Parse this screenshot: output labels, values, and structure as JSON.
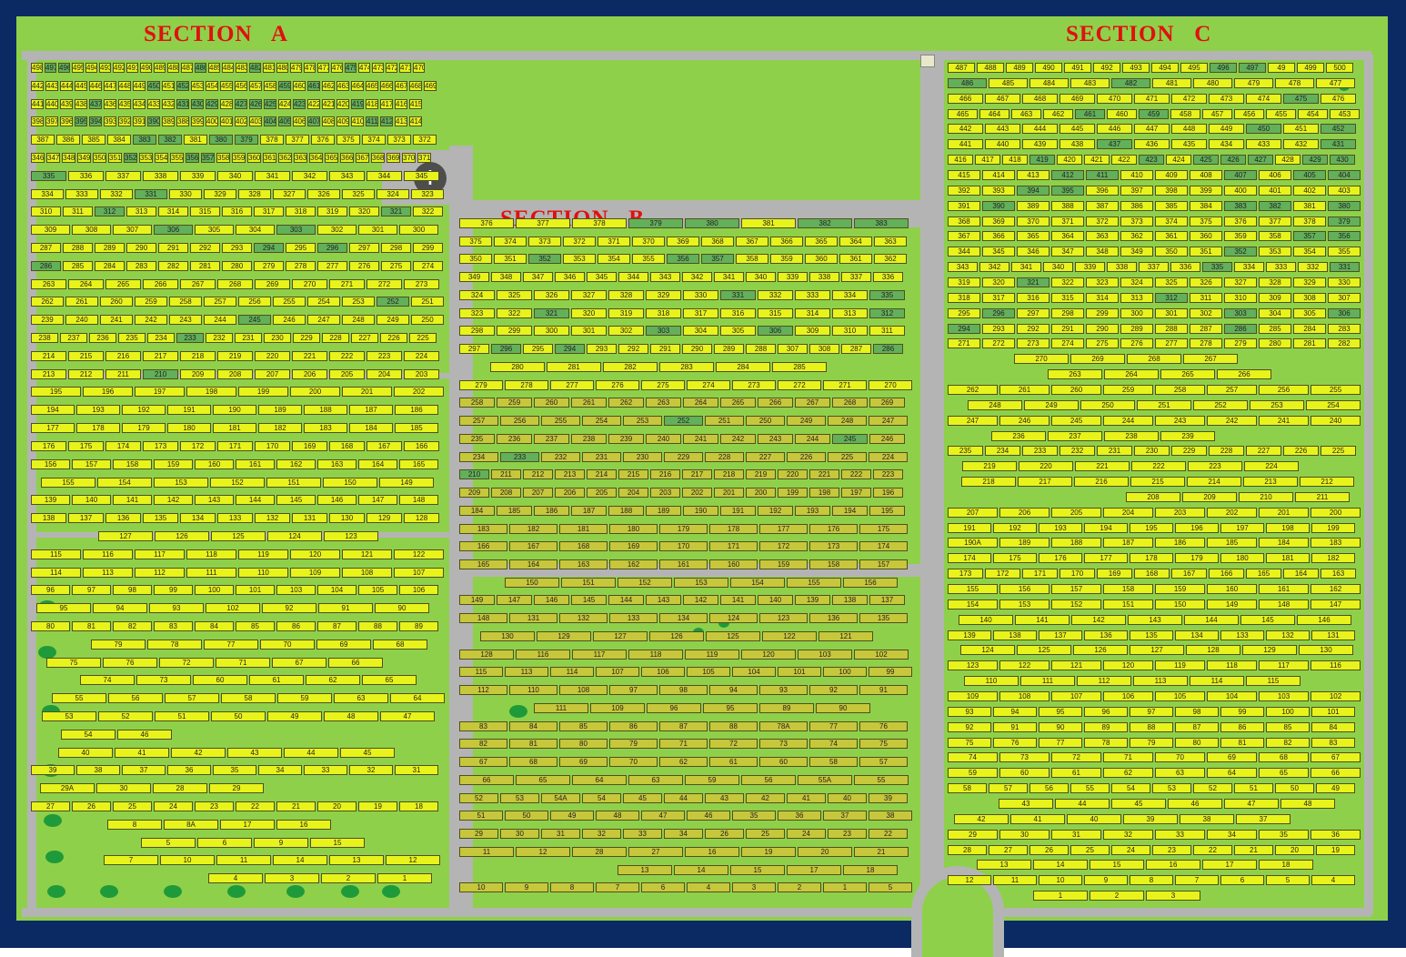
{
  "sections": {
    "a": {
      "label": "SECTION   A"
    },
    "b": {
      "label": "SECTION   B"
    },
    "c": {
      "label": "SECTION   C"
    }
  },
  "colors": {
    "available": "#e8f31c",
    "reserved": "#63b05a",
    "occupied": "#c7c73c",
    "road": "#b4b4b4",
    "lawn": "#8fd04a",
    "border": "#0b2a63"
  },
  "icons": {
    "chapel": "cross-icon",
    "gate": "gate-icon"
  },
  "section_a_rows": [
    "498 497 496 495 494 493 492 491 490 489 488 487 486 485 484 483 482 481 480 479 478 477 476 475 474 473 472 471 470",
    "442 443 444 445 446 447 448 449 450 451 452 453 454 455 456 457 458 459 460 461 462 463 464 465 466 467 468 469",
    "441 440 439 438 437 436 435 434 433 432 431 430 429 428 427 426 425 424 423 422 421 420 419 418 417 416 415",
    "398 397 396 395 394 393 392 391 390 389 388 399 400 401 402 403 404 405 406 407 408 409 410 411 412 413 414",
    "387 386 385 384 383 382 381 380 379 378 377 376 375 374 373 372",
    "346 347 348 349 350 351 352 353 354 355 356 357 358 359 360 361 362 363 364 365 366 367 368 369 370 371",
    "335 336 337 338 339 340 341 342 343 344 345",
    "334 333 332 331 330 329 328 327 326 325 324 323",
    "310 311 312 313 314 315 316 317 318 319 320 321 322",
    "309 308 307 306 305 304 303 302 301 300",
    "287 288 289 290 291 292 293 294 295 296 297 298 299",
    "286 285 284 283 282 281 280 279 278 277 276 275 274",
    "263 264 265 266 267 268 269 270 271 272 273",
    "262 261 260 259 258 257 256 255 254 253 252 251",
    "239 240 241 242 243 244 245 246 247 248 249 250",
    "238 237 236 235 234 233 232 231 230 229 228 227 226 225",
    "214 215 216 217 218 219 220 221 222 223 224",
    "213 212 211 210 209 208 207 206 205 204 203",
    "195 196 197 198 199 200 201 202",
    "194 193 192 191 190 189 188 187 186",
    "177 178 179 180 181 182 183 184 185",
    "176 175 174 173 172 171 170 169 168 167 166",
    "156 157 158 159 160 161 162 163 164 165",
    "155 154 153 152 151 150 149",
    "139 140 141 142 143 144 145 146 147 148",
    "138 137 136 135 134 133 132 131 130 129 128",
    "127 126 125 124 123",
    "115 116 117 118 119 120 121 122",
    "114 113 112 111 110 109 108 107",
    "96 97 98 99 100 101 103 104 105 106",
    "95 94 93 102 92 91 90",
    "80 81 82 83 84 85 86 87 88 89",
    "79 78 77 70 69 68",
    "75 76 72 71 67 66",
    "74 73 60 61 62 65",
    "55 56 57 58 59 63 64",
    "53 52 51 50 49 48 47",
    "54 46",
    "40 41 42 43 44 45",
    "39 38 37 36 35 34 33 32 31",
    "29A 30 28 29",
    "27 26 25 24 23 22 21 20 19 18",
    "8 8A 17 16",
    "5 6 9 15",
    "7 10 11 14 13 12",
    "4 3 2 1"
  ],
  "section_b_rows": [
    "376 377 378 379 380 381 382 383",
    "375 374 373 372 371 370 369 368 367 366 365 364 363",
    "350 351 352 353 354 355 356 357 358 359 360 361 362",
    "349 348 347 346 345 344 343 342 341 340 339 338 337 336",
    "324 325 326 327 328 329 330 331 332 333 334 335",
    "323 322 321 320 319 318 317 316 315 314 313 312",
    "298 299 300 301 302 303 304 305 306 309 310 311",
    "297 296 295 294 293 292 291 290 289 288 307 308 287 286",
    "280 281 282 283 284 285",
    "279 278 277 276 275 274 273 272 271 270",
    "258 259 260 261 262 263 264 265 266 267 268 269",
    "257 256 255 254 253 252 251 250 249 248 247",
    "235 236 237 238 239 240 241 242 243 244 245 246",
    "234 233 232 231 230 229 228 227 226 225 224",
    "210 211 212 213 214 215 216 217 218 219 220 221 222 223",
    "209 208 207 206 205 204 203 202 201 200 199 198 197 196",
    "184 185 186 187 188 189 190 191 192 193 194 195",
    "183 182 181 180 179 178 177 176 175",
    "166 167 168 169 170 171 172 173 174",
    "165 164 163 162 161 160 159 158 157",
    "150 151 152 153 154 155 156",
    "149 147 146 145 144 143 142 141 140 139 138 137",
    "148 131 132 133 134 124 123 136 135",
    "130 129 127 126 125 122 121",
    "128 116 117 118 119 120 103 102",
    "115 113 114 107 106 105 104 101 100 99",
    "112 110 108 97 98 94 93 92 91",
    "111 109 96 95 89 90",
    "83 84 85 86 87 88 78A 77 76",
    "82 81 80 79 71 72 73 74 75",
    "67 68 69 70 62 61 60 58 57",
    "66 65 64 63 59 56 55A 55",
    "52 53 54A 54 45 44 43 42 41 40 39",
    "51 50 49 48 47 46 35 36 37 38",
    "29 30 31 32 33 34 26 25 24 23 22",
    "11 12 28 27 16 19 20 21",
    "13 14 15 17 18",
    "10 9 8 7 6 4 3 2 1 5"
  ],
  "section_c_rows": [
    "487 488 489 490 491 492 493 494 495 496 497 49 499 500",
    "486 485 484 483 482 481 480 479 478 477",
    "466 467 468 469 470 471 472 473 474 475 476",
    "465 464 463 462 461 460 459 458 457 456 455 454 453",
    "442 443 444 445 446 447 448 449 450 451 452",
    "441 440 439 438 437 436 435 434 433 432 431",
    "416 417 418 419 420 421 422 423 424 425 426 427 428 429 430",
    "415 414 413 412 411 410 409 408 407 406 405 404",
    "392 393 394 395 396 397 398 399 400 401 402 403",
    "391 390 389 388 387 386 385 384 383 382 381 380",
    "368 369 370 371 372 373 374 375 376 377 378 379",
    "367 366 365 364 363 362 361 360 359 358 357 356",
    "344 345 346 347 348 349 350 351 352 353 354 355",
    "343 342 341 340 339 338 337 336 335 334 333 332 331",
    "319 320 321 322 323 324 325 326 327 328 329 330",
    "318 317 316 315 314 313 312 311 310 309 308 307",
    "295 296 297 298 299 300 301 302 303 304 305 306",
    "294 293 292 291 290 289 288 287 286 285 284 283",
    "271 272 273 274 275 276 277 278 279 280 281 282",
    "270 269 268 267",
    "263 264 265 266",
    "262 261 260 259 258 257 256 255",
    "248 249 250 251 252 253 254",
    "247 246 245 244 243 242 241 240",
    "236 237 238 239",
    "235 234 233 232 231 230 229 228 227 226 225",
    "219 220 221 222 223 224",
    "218 217 216 215 214 213 212",
    "208 209 210 211",
    "207 206 205 204 203 202 201 200",
    "191 192 193 194 195 196 197 198 199",
    "190A 189 188 187 186 185 184 183",
    "174 175 176 177 178 179 180 181 182",
    "173 172 171 170 169 168 167 166 165 164 163",
    "155 156 157 158 159 160 161 162",
    "154 153 152 151 150 149 148 147",
    "140 141 142 143 144 145 146",
    "139 138 137 136 135 134 133 132 131",
    "124 125 126 127 128 129 130",
    "123 122 121 120 119 118 117 116",
    "110 111 112 113 114 115",
    "109 108 107 106 105 104 103 102",
    "93 94 95 96 97 98 99 100 101",
    "92 91 90 89 88 87 86 85 84",
    "75 76 77 78 79 80 81 82 83",
    "74 73 72 71 70 69 68 67",
    "59 60 61 62 63 64 65 66",
    "58 57 56 55 54 53 52 51 50 49",
    "43 44 45 46 47 48",
    "42 41 40 39 38 37",
    "29 30 31 32 33 34 35 36",
    "28 27 26 25 24 23 22 21 20 19",
    "13 14 15 16 17 18",
    "12 11 10 9 8 7 6 5 4",
    "1 2 3"
  ],
  "reserved_plots": [
    "486",
    "482",
    "450",
    "430",
    "427",
    "426",
    "425",
    "419",
    "404",
    "394",
    "390",
    "331",
    "321",
    "294",
    "233",
    "296",
    "252",
    "245",
    "210",
    "412",
    "411",
    "395",
    "383",
    "382",
    "380",
    "379",
    "357",
    "356",
    "352",
    "335",
    "312",
    "303",
    "306",
    "286",
    "437",
    "431",
    "461",
    "459",
    "452",
    "429",
    "423",
    "425",
    "407",
    "405",
    "430",
    "475",
    "496",
    "497"
  ]
}
